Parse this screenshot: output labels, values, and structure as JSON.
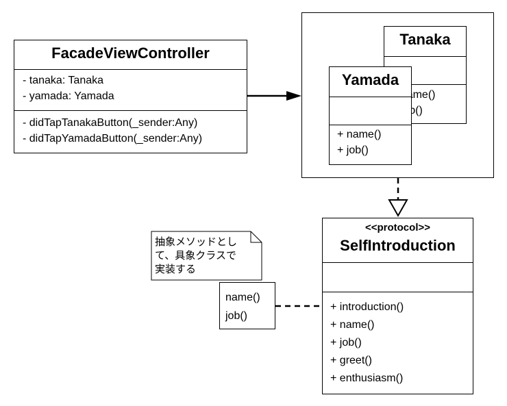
{
  "facade": {
    "name": "FacadeViewController",
    "attributes": [
      "- tanaka: Tanaka",
      "- yamada: Yamada"
    ],
    "methods": [
      "- didTapTanakaButton(_sender:Any)",
      "- didTapYamadaButton(_sender:Any)"
    ]
  },
  "tanaka": {
    "name": "Tanaka",
    "methods": [
      "+ name()",
      "+ job()"
    ]
  },
  "yamada": {
    "name": "Yamada",
    "methods": [
      "+ name()",
      "+ job()"
    ]
  },
  "protocol": {
    "stereotype": "<<protocol>>",
    "name": "SelfIntroduction",
    "methods": [
      "+ introduction()",
      "+ name()",
      "+ job()",
      "+ greet()",
      "+ enthusiasm()"
    ]
  },
  "note": {
    "lines": [
      "抽象メソッドとし",
      "て、具象クラスで",
      "実装する"
    ]
  },
  "impl_box": {
    "methods": [
      "name()",
      "job()"
    ]
  }
}
